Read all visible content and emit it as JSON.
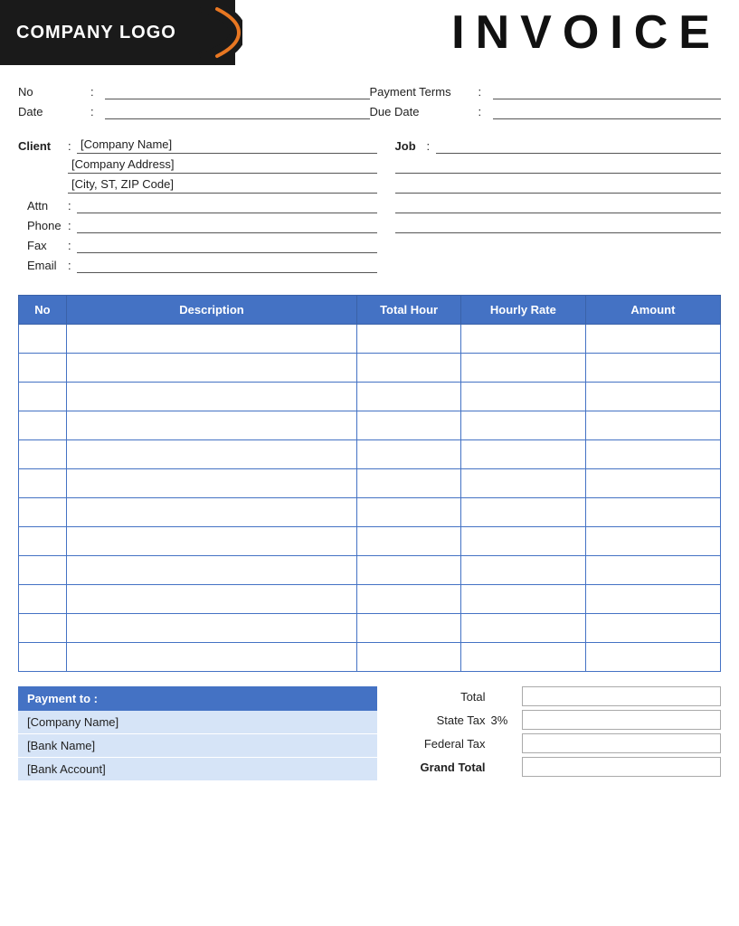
{
  "header": {
    "logo_text": "COMPANY LOGO",
    "invoice_title": "INVOICE"
  },
  "meta": {
    "left": [
      {
        "label": "No",
        "colon": ":",
        "value": ""
      },
      {
        "label": "Date",
        "colon": ":",
        "value": ""
      }
    ],
    "right": [
      {
        "label": "Payment  Terms",
        "colon": ":",
        "value": ""
      },
      {
        "label": "Due Date",
        "colon": ":",
        "value": ""
      }
    ]
  },
  "client": {
    "label": "Client",
    "colon": ":",
    "company_name": "[Company Name]",
    "company_address": "[Company Address]",
    "city_zip": "[City, ST, ZIP Code]",
    "fields": [
      {
        "label": "Attn",
        "colon": ":",
        "value": ""
      },
      {
        "label": "Phone",
        "colon": ":",
        "value": ""
      },
      {
        "label": "Fax",
        "colon": ":",
        "value": ""
      },
      {
        "label": "Email",
        "colon": ":",
        "value": ""
      }
    ]
  },
  "job": {
    "label": "Job",
    "colon": ":",
    "lines": [
      "",
      "",
      "",
      ""
    ]
  },
  "table": {
    "headers": [
      "No",
      "Description",
      "Total Hour",
      "Hourly Rate",
      "Amount"
    ],
    "rows": [
      [
        "",
        "",
        "",
        "",
        ""
      ],
      [
        "",
        "",
        "",
        "",
        ""
      ],
      [
        "",
        "",
        "",
        "",
        ""
      ],
      [
        "",
        "",
        "",
        "",
        ""
      ],
      [
        "",
        "",
        "",
        "",
        ""
      ],
      [
        "",
        "",
        "",
        "",
        ""
      ],
      [
        "",
        "",
        "",
        "",
        ""
      ],
      [
        "",
        "",
        "",
        "",
        ""
      ],
      [
        "",
        "",
        "",
        "",
        ""
      ],
      [
        "",
        "",
        "",
        "",
        ""
      ],
      [
        "",
        "",
        "",
        "",
        ""
      ],
      [
        "",
        "",
        "",
        "",
        ""
      ]
    ]
  },
  "payment": {
    "header": "Payment to :",
    "company_name": "[Company Name]",
    "bank_name": "[Bank Name]",
    "bank_account": "[Bank Account]"
  },
  "totals": {
    "total_label": "Total",
    "state_tax_label": "State Tax",
    "state_tax_pct": "3%",
    "federal_tax_label": "Federal Tax",
    "grand_total_label": "Grand Total"
  }
}
